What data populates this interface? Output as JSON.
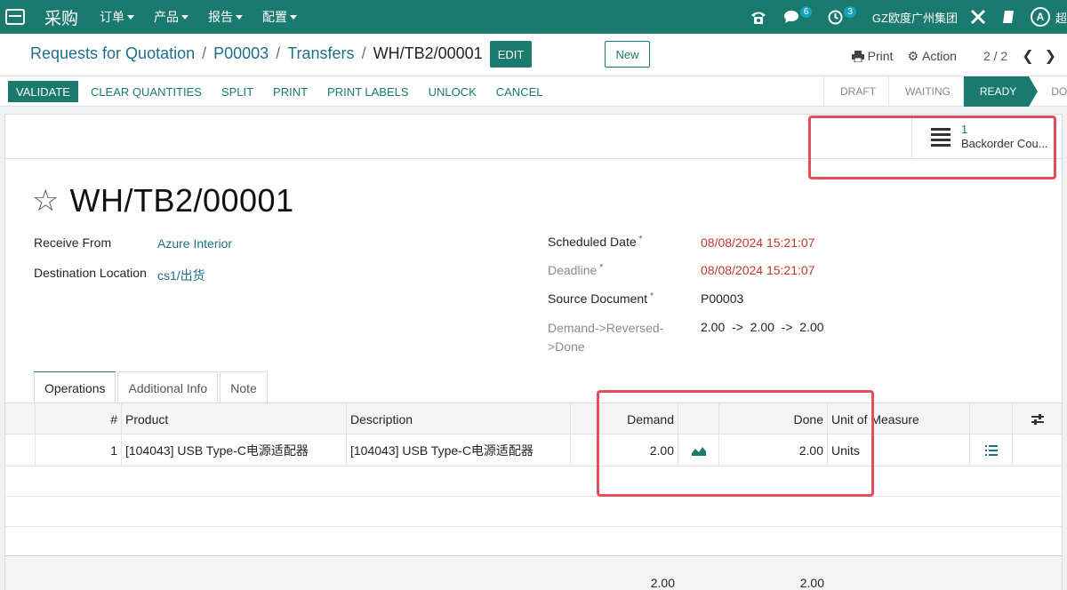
{
  "navbar": {
    "brand": "采购",
    "menus": [
      "订单",
      "产品",
      "报告",
      "配置"
    ],
    "messages_count": "6",
    "activities_count": "3",
    "company": "GZ欧度广州集团",
    "avatar_letter": "A",
    "user_name_partial": "超"
  },
  "control": {
    "breadcrumbs": [
      "Requests for Quotation",
      "P00003",
      "Transfers"
    ],
    "current": "WH/TB2/00001",
    "edit_label": "EDIT",
    "new_label": "New",
    "print_label": "Print",
    "action_label": "Action",
    "pager": "2 / 2"
  },
  "statusbar": {
    "buttons": [
      "VALIDATE",
      "CLEAR QUANTITIES",
      "SPLIT",
      "PRINT",
      "PRINT LABELS",
      "UNLOCK",
      "CANCEL"
    ],
    "states": [
      "DRAFT",
      "WAITING",
      "READY",
      "DONE"
    ],
    "active_state": "READY"
  },
  "smart_button": {
    "count": "1",
    "label": "Backorder Cou..."
  },
  "record": {
    "name": "WH/TB2/00001",
    "receive_from_label": "Receive From",
    "receive_from": "Azure Interior",
    "destination_label": "Destination Location",
    "destination": "cs1/出货",
    "scheduled_label": "Scheduled Date",
    "scheduled": "08/08/2024 15:21:07",
    "deadline_label": "Deadline",
    "deadline": "08/08/2024 15:21:07",
    "source_label": "Source Document",
    "source": "P00003",
    "demand_label_1": "Demand->Reversed-",
    "demand_label_2": ">Done",
    "demand_value": "2.00  ->  2.00  ->  2.00"
  },
  "tabs": [
    "Operations",
    "Additional Info",
    "Note"
  ],
  "table": {
    "headers": {
      "num": "#",
      "product": "Product",
      "description": "Description",
      "demand": "Demand",
      "done": "Done",
      "uom": "Unit of Measure"
    },
    "rows": [
      {
        "num": "1",
        "product": "[104043] USB Type-C电源适配器",
        "description": "[104043] USB Type-C电源适配器",
        "demand": "2.00",
        "done": "2.00",
        "uom": "Units"
      }
    ],
    "totals": {
      "demand": "2.00",
      "done": "2.00"
    }
  }
}
